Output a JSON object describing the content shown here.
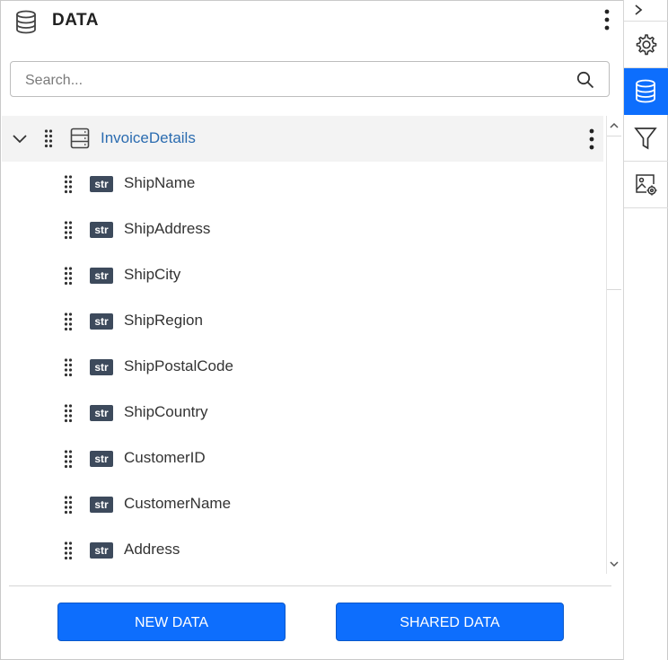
{
  "header": {
    "title": "DATA",
    "title_icon": "database-icon",
    "more_icon": "more-vertical-icon"
  },
  "search": {
    "placeholder": "Search...",
    "value": "",
    "icon": "search-icon"
  },
  "datasource": {
    "name": "InvoiceDetails",
    "expanded": true,
    "fields": [
      {
        "type": "str",
        "name": "ShipName"
      },
      {
        "type": "str",
        "name": "ShipAddress"
      },
      {
        "type": "str",
        "name": "ShipCity"
      },
      {
        "type": "str",
        "name": "ShipRegion"
      },
      {
        "type": "str",
        "name": "ShipPostalCode"
      },
      {
        "type": "str",
        "name": "ShipCountry"
      },
      {
        "type": "str",
        "name": "CustomerID"
      },
      {
        "type": "str",
        "name": "CustomerName"
      },
      {
        "type": "str",
        "name": "Address"
      }
    ]
  },
  "buttons": {
    "new_data": "NEW DATA",
    "shared_data": "SHARED DATA"
  },
  "rail": {
    "toggle_icon": "chevron-right-icon",
    "items": [
      {
        "icon": "gear-icon",
        "active": false
      },
      {
        "icon": "database-icon",
        "active": true
      },
      {
        "icon": "filter-icon",
        "active": false
      },
      {
        "icon": "image-settings-icon",
        "active": false
      }
    ]
  },
  "colors": {
    "accent": "#0d6efd",
    "datasource_link": "#2b6cb0",
    "badge": "#3d4a5c"
  }
}
